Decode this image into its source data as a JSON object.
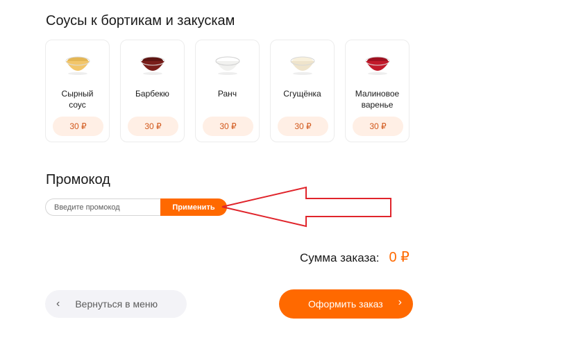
{
  "sauces_section": {
    "title": "Соусы к бортикам и закускам",
    "items": [
      {
        "name": "Сырный\nсоус",
        "price": "30 ₽",
        "color": "#f2c66b"
      },
      {
        "name": "Барбекю",
        "price": "30 ₽",
        "color": "#7a1e1a"
      },
      {
        "name": "Ранч",
        "price": "30 ₽",
        "color": "#f4f4f2"
      },
      {
        "name": "Сгущёнка",
        "price": "30 ₽",
        "color": "#f3ead6"
      },
      {
        "name": "Малиновое\nваренье",
        "price": "30 ₽",
        "color": "#c21a2b"
      }
    ]
  },
  "promo": {
    "title": "Промокод",
    "placeholder": "Введите промокод",
    "apply_label": "Применить"
  },
  "order": {
    "total_label": "Сумма заказа:",
    "total_value": "0 ₽"
  },
  "footer": {
    "back_label": "Вернуться в меню",
    "back_icon": "chevron-left-icon",
    "checkout_label": "Оформить заказ",
    "checkout_icon": "chevron-right-icon"
  },
  "annotation": {
    "arrow_color": "#e0242b",
    "arrow_icon": "left-arrow-annotation"
  },
  "colors": {
    "accent": "#ff6900",
    "price_bg": "#ffefe5",
    "price_text": "#d1571a"
  }
}
